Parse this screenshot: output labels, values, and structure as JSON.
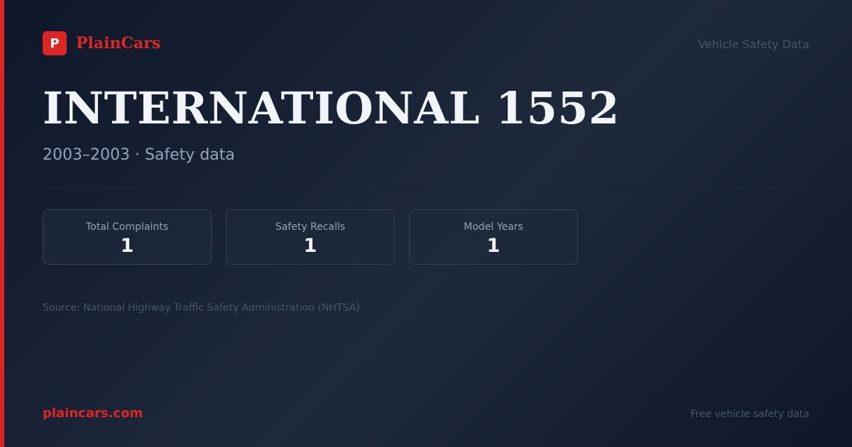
{
  "brand": {
    "logo_letter": "P",
    "name": "PlainCars"
  },
  "header": {
    "tagline": "Vehicle Safety Data"
  },
  "vehicle": {
    "title": "INTERNATIONAL 1552",
    "subtitle": "2003–2003 · Safety data"
  },
  "stats": [
    {
      "label": "Total Complaints",
      "value": "1"
    },
    {
      "label": "Safety Recalls",
      "value": "1"
    },
    {
      "label": "Model Years",
      "value": "1"
    }
  ],
  "source": "Source: National Highway Traffic Safety Administration (NHTSA)",
  "footer": {
    "domain": "plaincars.com",
    "tagline": "Free vehicle safety data"
  },
  "colors": {
    "accent": "#dc2626",
    "background": "#0f172a",
    "text_primary": "#f1f5f9",
    "text_secondary": "#94a3b8",
    "text_muted": "#475569"
  }
}
